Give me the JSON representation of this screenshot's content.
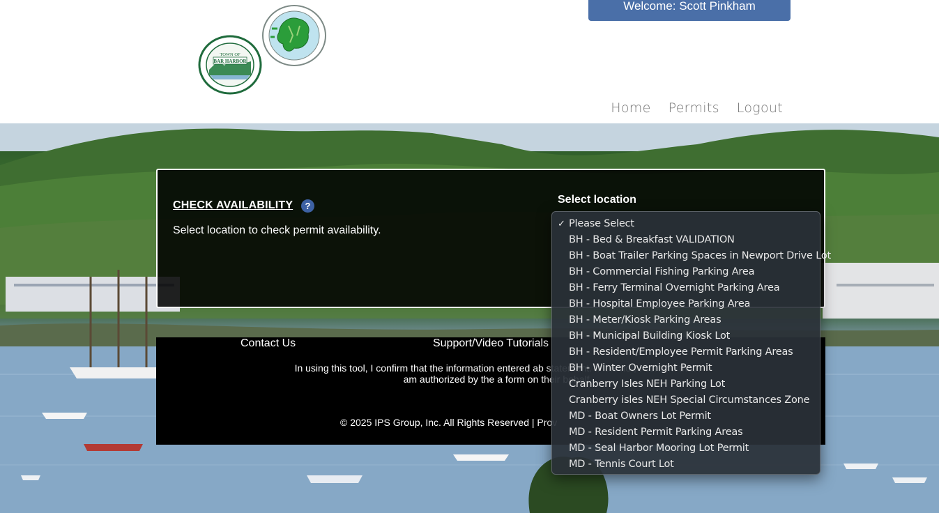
{
  "header": {
    "welcome_text": "Welcome:  Scott Pinkham",
    "nav": [
      "Home",
      "Permits",
      "Logout"
    ]
  },
  "seals": {
    "bar_harbor": {
      "top": "TOWN OF",
      "middle": "BAR HARBOR",
      "ring": "COUNTY OF HANCOCK · STATE OF MAINE",
      "bottom": "INCORPORATED 1796"
    },
    "mount_desert": {
      "ring": "TOWN OF MOUNT DESERT",
      "bottom": "INCORPORATED 1789"
    }
  },
  "check_availability": {
    "title": "CHECK AVAILABILITY",
    "help_icon": "?",
    "description": "Select location to check permit availability.",
    "select_label": "Select location"
  },
  "dropdown": {
    "selected_index": 0,
    "options": [
      "Please Select",
      "BH - Bed & Breakfast VALIDATION",
      "BH - Boat Trailer Parking Spaces in Newport Drive Lot",
      "BH - Commercial Fishing Parking Area",
      "BH - Ferry Terminal Overnight Parking Area",
      "BH - Hospital Employee Parking Area",
      "BH - Meter/Kiosk Parking Areas",
      "BH - Municipal Building Kiosk Lot",
      "BH - Resident/Employee Permit Parking Areas",
      "BH - Winter Overnight Permit",
      "Cranberry Isles NEH Parking Lot",
      "Cranberry isles NEH Special Circumstances Zone",
      "MD - Boat Owners Lot Permit",
      "MD - Resident Permit Parking Areas",
      "MD - Seal Harbor Mooring Lot Permit",
      "MD - Tennis Court Lot"
    ]
  },
  "footer": {
    "contact": "Contact Us",
    "support": "Support/Video Tutorials",
    "note": "In using this tool, I confirm that the information entered ab statement. If it is not, I confirm that I am authorized by the a form on their behalf.",
    "copyright": "© 2025 IPS Group, Inc. All Rights Reserved  |  Prov"
  },
  "colors": {
    "accent": "#4a6fa8",
    "panel_bg": "#000000",
    "help": "#3d61a3"
  }
}
